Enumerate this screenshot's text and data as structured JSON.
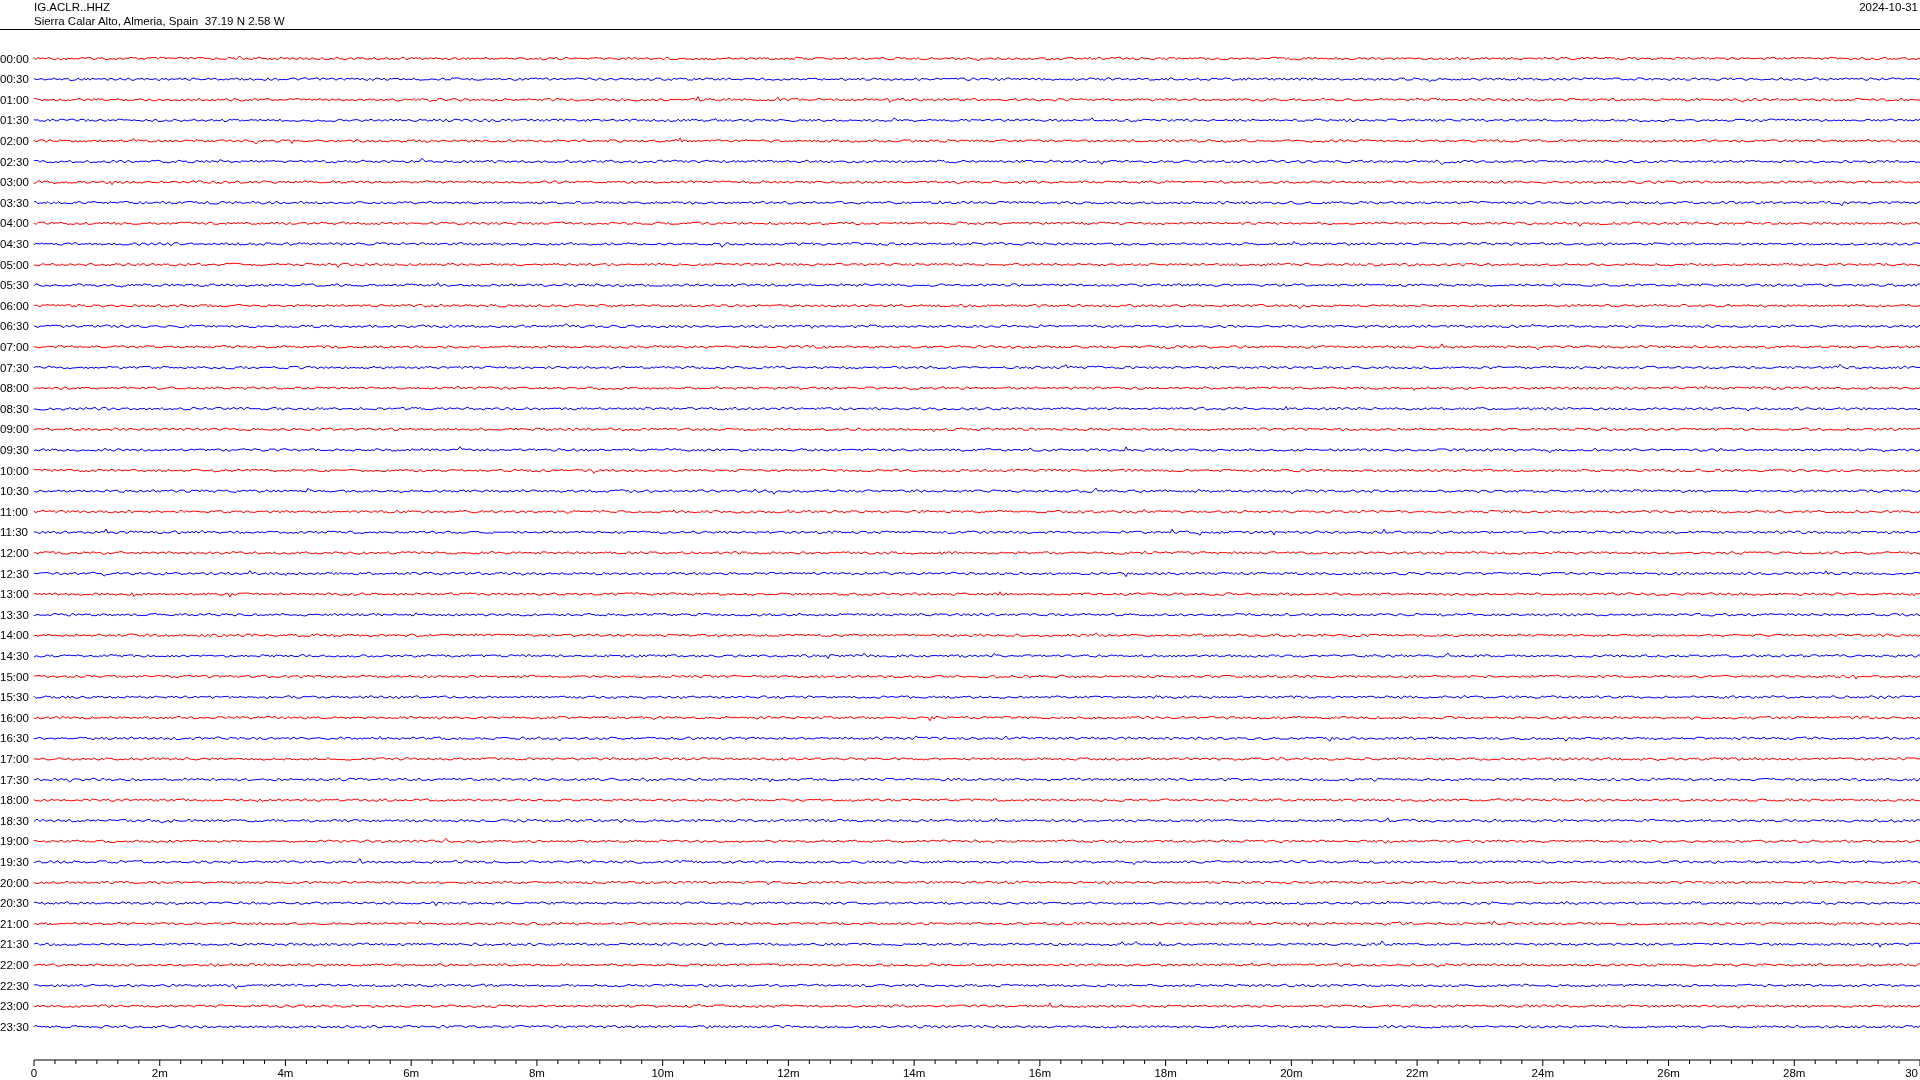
{
  "station": "IG.ACLR..HHZ",
  "location": "Sierra Calar Alto, Almeria, Spain  37.19 N 2.58 W",
  "date": "2024-10-31",
  "rows": [
    {
      "label": "00:00",
      "color": "#ff0000"
    },
    {
      "label": "00:30",
      "color": "#0000ff"
    },
    {
      "label": "01:00",
      "color": "#ff0000"
    },
    {
      "label": "01:30",
      "color": "#0000ff"
    },
    {
      "label": "02:00",
      "color": "#ff0000"
    },
    {
      "label": "02:30",
      "color": "#0000ff"
    },
    {
      "label": "03:00",
      "color": "#ff0000"
    },
    {
      "label": "03:30",
      "color": "#0000ff"
    },
    {
      "label": "04:00",
      "color": "#ff0000"
    },
    {
      "label": "04:30",
      "color": "#0000ff"
    },
    {
      "label": "05:00",
      "color": "#ff0000"
    },
    {
      "label": "05:30",
      "color": "#0000ff"
    },
    {
      "label": "06:00",
      "color": "#ff0000"
    },
    {
      "label": "06:30",
      "color": "#0000ff"
    },
    {
      "label": "07:00",
      "color": "#ff0000"
    },
    {
      "label": "07:30",
      "color": "#0000ff"
    },
    {
      "label": "08:00",
      "color": "#ff0000"
    },
    {
      "label": "08:30",
      "color": "#0000ff"
    },
    {
      "label": "09:00",
      "color": "#ff0000"
    },
    {
      "label": "09:30",
      "color": "#0000ff"
    },
    {
      "label": "10:00",
      "color": "#ff0000"
    },
    {
      "label": "10:30",
      "color": "#0000ff"
    },
    {
      "label": "11:00",
      "color": "#ff0000"
    },
    {
      "label": "11:30",
      "color": "#0000ff"
    },
    {
      "label": "12:00",
      "color": "#ff0000"
    },
    {
      "label": "12:30",
      "color": "#0000ff"
    },
    {
      "label": "13:00",
      "color": "#ff0000"
    },
    {
      "label": "13:30",
      "color": "#0000ff"
    },
    {
      "label": "14:00",
      "color": "#ff0000"
    },
    {
      "label": "14:30",
      "color": "#0000ff"
    },
    {
      "label": "15:00",
      "color": "#ff0000"
    },
    {
      "label": "15:30",
      "color": "#0000ff"
    },
    {
      "label": "16:00",
      "color": "#ff0000"
    },
    {
      "label": "16:30",
      "color": "#0000ff"
    },
    {
      "label": "17:00",
      "color": "#ff0000"
    },
    {
      "label": "17:30",
      "color": "#0000ff"
    },
    {
      "label": "18:00",
      "color": "#ff0000"
    },
    {
      "label": "18:30",
      "color": "#0000ff"
    },
    {
      "label": "19:00",
      "color": "#ff0000"
    },
    {
      "label": "19:30",
      "color": "#0000ff"
    },
    {
      "label": "20:00",
      "color": "#ff0000"
    },
    {
      "label": "20:30",
      "color": "#0000ff"
    },
    {
      "label": "21:00",
      "color": "#ff0000"
    },
    {
      "label": "21:30",
      "color": "#0000ff"
    },
    {
      "label": "22:00",
      "color": "#ff0000"
    },
    {
      "label": "22:30",
      "color": "#0000ff"
    },
    {
      "label": "23:00",
      "color": "#ff0000"
    },
    {
      "label": "23:30",
      "color": "#0000ff"
    }
  ],
  "x_axis": {
    "ticks": [
      "0",
      "2m",
      "4m",
      "6m",
      "8m",
      "10m",
      "12m",
      "14m",
      "16m",
      "18m",
      "20m",
      "22m",
      "24m",
      "26m",
      "28m",
      "30"
    ]
  }
}
